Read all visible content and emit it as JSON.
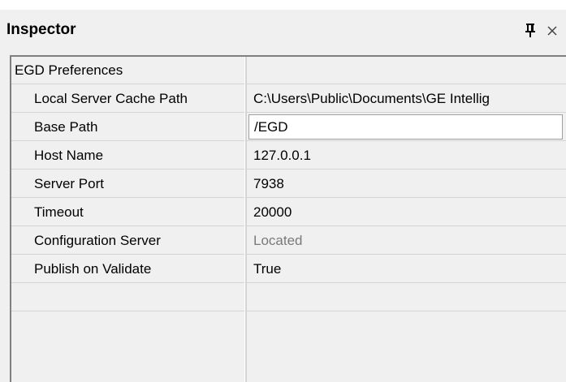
{
  "window": {
    "title": "Inspector",
    "pin_icon": "pin-icon",
    "close_icon": "close-icon"
  },
  "grid": {
    "category": "EGD Preferences",
    "properties": [
      {
        "name": "Local Server Cache Path",
        "value": "C:\\Users\\Public\\Documents\\GE Intellig"
      },
      {
        "name": "Base Path",
        "value": "/EGD"
      },
      {
        "name": "Host Name",
        "value": "127.0.0.1"
      },
      {
        "name": "Server Port",
        "value": "7938"
      },
      {
        "name": "Timeout",
        "value": "20000"
      },
      {
        "name": "Configuration Server",
        "value": "Located"
      },
      {
        "name": "Publish on Validate",
        "value": "True"
      }
    ]
  },
  "colors": {
    "panel_background": "#f0f0f0",
    "grid_line": "#d4d4d4",
    "disabled_text": "#7a7a7a",
    "edit_background": "#ffffff"
  }
}
